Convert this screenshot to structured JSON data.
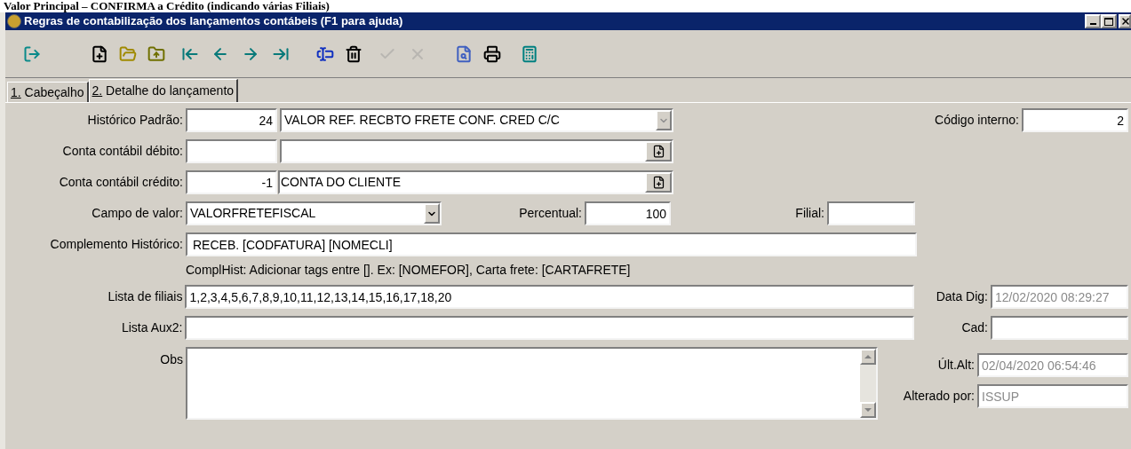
{
  "caption": "Valor Principal – CONFIRMA a Crédito (indicando várias Filiais)",
  "window": {
    "title": "Regras de contabilização dos lançamentos contábeis (F1 para ajuda)"
  },
  "toolbar": [
    {
      "kind": "exit",
      "disabled": false
    },
    {
      "kind": "new",
      "disabled": false
    },
    {
      "kind": "open",
      "disabled": false
    },
    {
      "kind": "folder",
      "disabled": false
    },
    {
      "kind": "first",
      "disabled": false
    },
    {
      "kind": "prev",
      "disabled": false
    },
    {
      "kind": "next",
      "disabled": false
    },
    {
      "kind": "last",
      "disabled": false
    },
    {
      "kind": "rename",
      "disabled": false
    },
    {
      "kind": "delete",
      "disabled": false
    },
    {
      "kind": "confirm",
      "disabled": true
    },
    {
      "kind": "cancel",
      "disabled": true
    },
    {
      "kind": "preview",
      "disabled": false
    },
    {
      "kind": "print",
      "disabled": false
    },
    {
      "kind": "calculator",
      "disabled": false
    }
  ],
  "tabs": [
    {
      "label": "1. Cabeçalho",
      "selected": false
    },
    {
      "label": "2. Detalhe do lançamento",
      "selected": true
    }
  ],
  "form": {
    "historico_padrao": {
      "label": "Histórico Padrão:",
      "code": "24",
      "description": "VALOR REF. RECBTO FRETE CONF. CRED C/C",
      "dropdown_disabled": true
    },
    "codigo_interno": {
      "label": "Código interno:",
      "value": "2"
    },
    "conta_debito": {
      "label": "Conta contábil débito:"
    },
    "conta_credito": {
      "label": "Conta contábil crédito:",
      "code": "-1",
      "description": "CONTA DO CLIENTE"
    },
    "campo_valor": {
      "label": "Campo de valor:",
      "value": "VALORFRETEFISCAL"
    },
    "percentual": {
      "label": "Percentual:",
      "value": "100"
    },
    "filial": {
      "label": "Filial:"
    },
    "complemento": {
      "label": "Complemento Histórico:",
      "value": "RECEB. [CODFATURA] [NOMECLI]"
    },
    "hint": "ComplHist: Adicionar tags entre []. Ex: [NOMEFOR], Carta frete: [CARTAFRETE]",
    "lista_filiais": {
      "label": "Lista de filiais",
      "value": "1,2,3,4,5,6,7,8,9,10,11,12,13,14,15,16,17,18,20"
    },
    "data_dig": {
      "label": "Data Dig:",
      "value": "12/02/2020 08:29:27",
      "disabled": true
    },
    "lista_aux2": {
      "label": "Lista Aux2:"
    },
    "cad": {
      "label": "Cad:"
    },
    "obs": {
      "label": "Obs"
    },
    "ult_alt": {
      "label": "Últ.Alt:",
      "value": "02/04/2020 06:54:46",
      "disabled": true
    },
    "alterado_por": {
      "label": "Alterado por:",
      "value": "ISSUP",
      "disabled": true
    }
  }
}
